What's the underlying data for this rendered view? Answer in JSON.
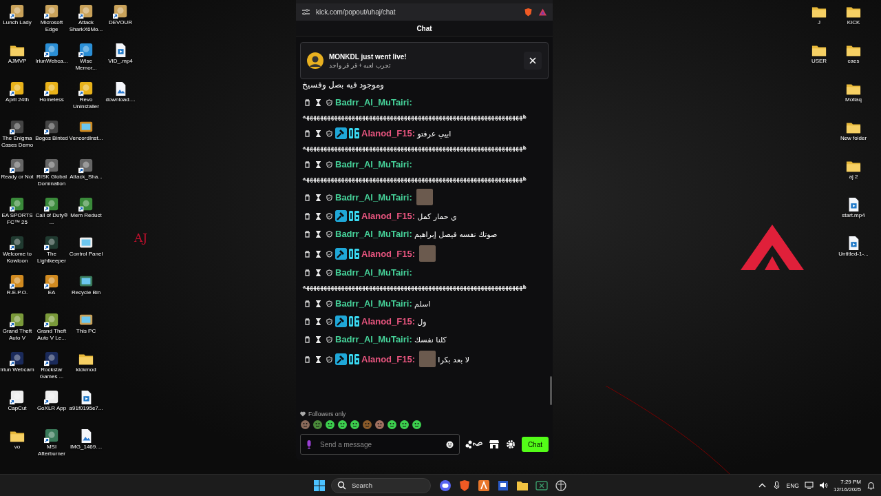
{
  "desktop": {
    "wallpaper_mark": "AJ",
    "left_columns": [
      [
        {
          "label": "Lunch Lady",
          "kind": "shortcut"
        },
        {
          "label": "AJMVP",
          "kind": "folder"
        },
        {
          "label": "April 24th",
          "kind": "shortcut"
        },
        {
          "label": "The Enigma Cases Demo",
          "kind": "shortcut"
        },
        {
          "label": "Ready or Not",
          "kind": "shortcut"
        },
        {
          "label": "EA SPORTS FC™ 25",
          "kind": "shortcut"
        },
        {
          "label": "Welcome to Kowloon",
          "kind": "shortcut"
        },
        {
          "label": "R.E.P.O.",
          "kind": "shortcut"
        },
        {
          "label": "Grand Theft Auto V",
          "kind": "shortcut"
        },
        {
          "label": "Iriun Webcam",
          "kind": "shortcut"
        },
        {
          "label": "CapCut",
          "kind": "shortcut"
        },
        {
          "label": "vo",
          "kind": "folder"
        }
      ],
      [
        {
          "label": "Microsoft Edge",
          "kind": "shortcut"
        },
        {
          "label": "IriunWebca...",
          "kind": "shortcut"
        },
        {
          "label": "Homeless",
          "kind": "shortcut"
        },
        {
          "label": "Bogos Binted",
          "kind": "shortcut"
        },
        {
          "label": "RISK Global Domination",
          "kind": "shortcut"
        },
        {
          "label": "Call of Duty® ...",
          "kind": "shortcut"
        },
        {
          "label": "The Lightkeeper",
          "kind": "shortcut"
        },
        {
          "label": "EA",
          "kind": "shortcut"
        },
        {
          "label": "Grand Theft Auto V Le...",
          "kind": "shortcut"
        },
        {
          "label": "Rockstar Games ...",
          "kind": "shortcut"
        },
        {
          "label": "GoXLR App",
          "kind": "shortcut"
        },
        {
          "label": "MSI Afterburner",
          "kind": "shortcut"
        }
      ],
      [
        {
          "label": "Attack SharkX6Mo...",
          "kind": "shortcut"
        },
        {
          "label": "Wise Memor...",
          "kind": "shortcut"
        },
        {
          "label": "Revo Uninstaller",
          "kind": "shortcut"
        },
        {
          "label": "VencordInst...",
          "kind": "system"
        },
        {
          "label": "Attack_Sha...",
          "kind": "shortcut"
        },
        {
          "label": "Mem Reduct",
          "kind": "shortcut"
        },
        {
          "label": "Control Panel",
          "kind": "system"
        },
        {
          "label": "Recycle Bin",
          "kind": "system"
        },
        {
          "label": "This PC",
          "kind": "system"
        },
        {
          "label": "kickmod",
          "kind": "folder"
        },
        {
          "label": "a91f0195e7...",
          "kind": "video"
        },
        {
          "label": "IMG_1469....",
          "kind": "image"
        }
      ],
      [
        {
          "label": "DEVOUR",
          "kind": "shortcut"
        },
        {
          "label": "VID_.mp4",
          "kind": "video"
        },
        {
          "label": "download....",
          "kind": "image"
        }
      ]
    ],
    "right_columns": [
      [
        {
          "label": "J",
          "kind": "folder"
        },
        {
          "label": "USER",
          "kind": "folder"
        }
      ],
      [
        {
          "label": "KICK",
          "kind": "folder"
        },
        {
          "label": "caes",
          "kind": "folder"
        },
        {
          "label": "Motlaq",
          "kind": "folder"
        },
        {
          "label": "New folder",
          "kind": "folder"
        },
        {
          "label": "aj 2",
          "kind": "folder"
        },
        {
          "label": "start.mp4",
          "kind": "video"
        },
        {
          "label": "Untitled-1-...",
          "kind": "video"
        }
      ]
    ]
  },
  "browser": {
    "url": "kick.com/popout/uhaj/chat"
  },
  "chat": {
    "title": "Chat",
    "notification": {
      "title": "MONKDL just went live!",
      "subtitle": "تجرب لعبه + قر قر واجد"
    },
    "messages": [
      {
        "kind": "continuation",
        "text": "وموجود فيه بصل وفسيخ"
      },
      {
        "kind": "message",
        "user": "Badrr_Al_MuTairi:",
        "color": "#46d39a",
        "badges": false,
        "emote": false,
        "body": "هههههههههههههههههههههههههههههههههههههههههههههههههههههههههههههههه"
      },
      {
        "kind": "message",
        "user": "Alanod_F15:",
        "color": "#e8557f",
        "badges": true,
        "emote": false,
        "text": "ابيي عرفتو",
        "body": "هههههههههههههههههههههههههههههههههههههههههههههههههههههههههههههههه"
      },
      {
        "kind": "message",
        "user": "Badrr_Al_MuTairi:",
        "color": "#46d39a",
        "badges": false,
        "emote": false,
        "body": "هههههههههههههههههههههههههههههههههههههههههههههههههههههههههههههههه"
      },
      {
        "kind": "message",
        "user": "Badrr_Al_MuTairi:",
        "color": "#46d39a",
        "badges": false,
        "emote": true
      },
      {
        "kind": "message",
        "user": "Alanod_F15:",
        "color": "#e8557f",
        "badges": true,
        "emote": false,
        "text": "ي حمار كمل"
      },
      {
        "kind": "message",
        "user": "Badrr_Al_MuTairi:",
        "color": "#46d39a",
        "badges": false,
        "emote": false,
        "text": "صوتك نفسه فيصل إبراهيم"
      },
      {
        "kind": "message",
        "user": "Alanod_F15:",
        "color": "#e8557f",
        "badges": true,
        "emote": true
      },
      {
        "kind": "message",
        "user": "Badrr_Al_MuTairi:",
        "color": "#46d39a",
        "badges": false,
        "emote": false,
        "body": "هههههههههههههههههههههههههههههههههههههههههههههههههههههههههههههههه"
      },
      {
        "kind": "message",
        "user": "Badrr_Al_MuTairi:",
        "color": "#46d39a",
        "badges": false,
        "emote": false,
        "text": "اسلم"
      },
      {
        "kind": "message",
        "user": "Alanod_F15:",
        "color": "#e8557f",
        "badges": true,
        "emote": false,
        "text": "ول"
      },
      {
        "kind": "message",
        "user": "Badrr_Al_MuTairi:",
        "color": "#46d39a",
        "badges": false,
        "emote": false,
        "text": "كلنا نفسك"
      },
      {
        "kind": "message",
        "user": "Alanod_F15:",
        "color": "#e8557f",
        "badges": true,
        "emote": true,
        "text": "لا بعد بكرا"
      }
    ],
    "followers_only": "Followers only",
    "input": {
      "placeholder": "Send a message"
    },
    "send_button": "Chat"
  },
  "taskbar": {
    "search_placeholder": "Search",
    "language": "ENG",
    "time": "7:29 PM",
    "date": "12/16/2025"
  }
}
